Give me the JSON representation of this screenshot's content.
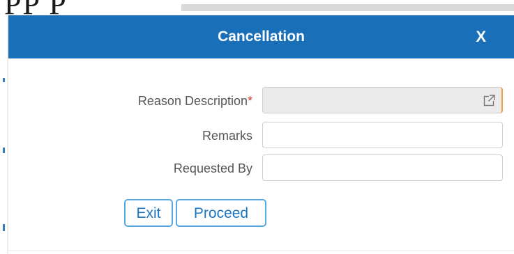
{
  "dialog": {
    "title": "Cancellation",
    "close_label": "X"
  },
  "form": {
    "reason_label": "Reason Description",
    "required_mark": "*",
    "reason_value": "",
    "remarks_label": "Remarks",
    "remarks_value": "",
    "requested_by_label": "Requested By",
    "requested_by_value": ""
  },
  "buttons": {
    "exit_label": "Exit",
    "proceed_label": "Proceed"
  },
  "colors": {
    "header": "#1a6fb9",
    "accent": "#56a8e0",
    "required": "#d9342b"
  }
}
